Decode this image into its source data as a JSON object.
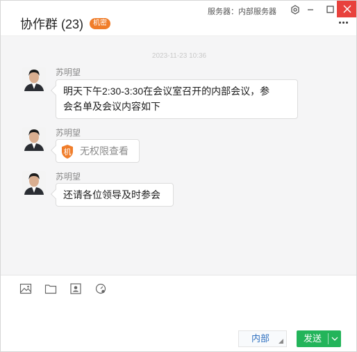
{
  "window": {
    "title": "协作群 (23)",
    "badge": "机密",
    "server_label": "服务器：内部服务器"
  },
  "icons": {
    "settings": "gear-icon",
    "minimize": "minimize-icon",
    "maximize": "maximize-icon",
    "close": "close-icon",
    "more": "more-icon",
    "image": "image-icon",
    "folder": "folder-icon",
    "contact": "contact-card-icon",
    "screenshot": "screenshot-icon"
  },
  "chat": {
    "timestamp": "2023-11-23  10:36",
    "messages": [
      {
        "sender": "苏明望",
        "lines": [
          "明天下午2:30-3:30在会议室召开的内部会议，参",
          "会名单及会议内容如下"
        ]
      },
      {
        "sender": "苏明望",
        "lock_glyph": "机",
        "text": "无权限查看"
      },
      {
        "sender": "苏明望",
        "text": "还请各位领导及时参会"
      }
    ]
  },
  "footer": {
    "scope_label": "内部",
    "send_label": "发送"
  },
  "colors": {
    "close": "#e8413c",
    "badge": "#f07d2a",
    "send": "#23b45a",
    "scope_text": "#3071c0",
    "chat_bg": "#f5f5f6"
  }
}
